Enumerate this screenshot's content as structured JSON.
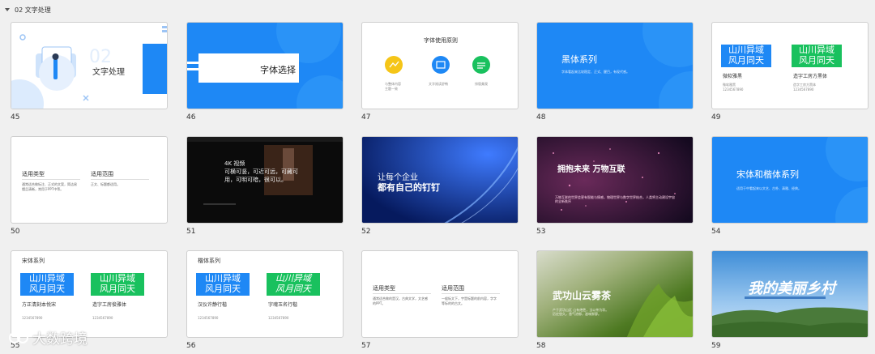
{
  "section": {
    "title": "02 文字处理"
  },
  "slides": [
    {
      "num": "45",
      "title": "文字处理",
      "big": "02"
    },
    {
      "num": "46",
      "title": "字体选择"
    },
    {
      "num": "47",
      "title": "字体使用原则",
      "items": [
        "与整体内容\n主题一致",
        "文字阅读舒畅",
        "排版美观"
      ]
    },
    {
      "num": "48",
      "title": "黑体系列",
      "desc": "字体看起来比较稳定、正式、醒目，有现代感。"
    },
    {
      "num": "49",
      "badge1": [
        "山川异域",
        "风月同天"
      ],
      "badge2": [
        "山川异域",
        "风月同天"
      ],
      "cap1": "微软雅黑",
      "cap1b": "1234567890",
      "cap2": "造字工房方黑体",
      "cap2b": "1234567890",
      "sub1": "微软雅黑",
      "sub2": "造字工房方黑体"
    },
    {
      "num": "50",
      "h1": "适用类型",
      "h2": "适用范围",
      "p1": "通常适合做标注、正式的文案，简洁易懂且清晰，常用于PPT中等。",
      "p2": "正文、标题都适用。"
    },
    {
      "num": "51",
      "h1": "4K 视频",
      "h2": "可横可竖，可近可远，可藏可",
      "h3": "用，可明可暗，很可以。"
    },
    {
      "num": "52",
      "l1": "让每个企业",
      "l2": "都有自己的钉钉"
    },
    {
      "num": "53",
      "title": "拥抱未来 万物互联",
      "sub": "万物互联的世界会更有智能与情感，物理世界与数字世界结合，人类将主动建设宇宙的全新秩序"
    },
    {
      "num": "54",
      "title": "宋体和楷体系列",
      "desc": "适用于中看起来以文艺、古朴、清雅、经典。"
    },
    {
      "num": "55",
      "title": "宋体系列",
      "badge1": [
        "山川异域",
        "风月同天"
      ],
      "badge2": [
        "山川异域",
        "风月同天"
      ],
      "cap1": "方正清刻本悦宋",
      "cap1b": "1234567890",
      "cap2": "造字工房俊雅体",
      "cap2b": "1234567890"
    },
    {
      "num": "56",
      "title": "楷体系列",
      "badge1": [
        "山川异域",
        "风月同天"
      ],
      "badge2": [
        "山川异域",
        "风月同天"
      ],
      "cap1": "汉仪许静行楷",
      "cap1b": "1234567890",
      "cap2": "字魂玉名行楷",
      "cap2b": "1234567890"
    },
    {
      "num": "57",
      "h1": "适用类型",
      "h2": "适用范围",
      "p1": "通常适合做的是汉，古典文学，文艺感的PPT。",
      "p2": "一般标文下，宇是标题的前内容，字字等标的的古文。"
    },
    {
      "num": "58",
      "title": "武功山云雾茶",
      "p": "产于武功山区 山有绝胜，当以茶为珍。历史悠久，香气浓郁，滋味鲜醇。"
    },
    {
      "num": "59",
      "title": "我的美丽乡村"
    }
  ],
  "watermark": {
    "text": "大数跨境"
  }
}
